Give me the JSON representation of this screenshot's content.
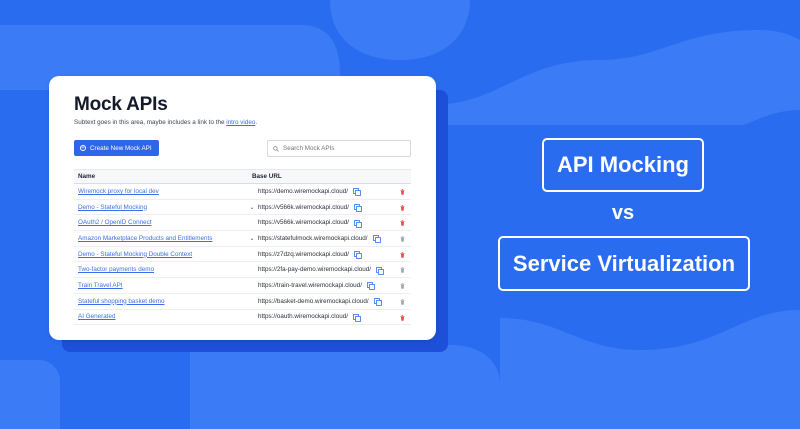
{
  "card": {
    "title": "Mock APIs",
    "subtext_prefix": "Subtext goes in this area, maybe includes a link to the ",
    "subtext_link": "intro video",
    "subtext_suffix": ".",
    "create_button_label": "Create New Mock API",
    "search_placeholder": "Search Mock APIs"
  },
  "table": {
    "headers": {
      "name": "Name",
      "url": "Base URL"
    },
    "rows": [
      {
        "name": "Wiremock proxy for local dev",
        "url": "https://demo.wiremockapi.cloud/",
        "expandable": false,
        "deletable": true
      },
      {
        "name": "Demo - Stateful Mocking",
        "url": "https://v566k.wiremockapi.cloud/",
        "expandable": true,
        "deletable": true
      },
      {
        "name": "OAuth2 / OpenID Connect",
        "url": "https://v566k.wiremockapi.cloud/",
        "expandable": false,
        "deletable": true
      },
      {
        "name": "Amazon Marketplace Products and Entitlements",
        "url": "https://statefulmock.wiremockapi.cloud/",
        "expandable": true,
        "deletable": false
      },
      {
        "name": "Demo - Stateful Mocking Double Context",
        "url": "https://z7dzq.wiremockapi.cloud/",
        "expandable": false,
        "deletable": true
      },
      {
        "name": "Two-factor payments demo",
        "url": "https://2fa-pay-demo.wiremockapi.cloud/",
        "expandable": false,
        "deletable": false
      },
      {
        "name": "Train Travel API",
        "url": "https://train-travel.wiremockapi.cloud/",
        "expandable": false,
        "deletable": false
      },
      {
        "name": "Stateful shopping basket demo",
        "url": "https://basket-demo.wiremockapi.cloud/",
        "expandable": false,
        "deletable": false
      },
      {
        "name": "AI Generated",
        "url": "https://oauth.wiremockapi.cloud/",
        "expandable": false,
        "deletable": true
      }
    ]
  },
  "labels": {
    "left_term": "API Mocking",
    "versus": "vs",
    "right_term": "Service Virtualization"
  },
  "colors": {
    "background": "#2a6cf0",
    "accent": "#2e66e9",
    "link": "#3a6fe8",
    "delete_active": "#e0534a"
  },
  "icons": {
    "search": "search-icon",
    "copy": "copy-icon",
    "delete": "trash-icon",
    "expand": "chevron-down-icon",
    "create": "plus-circle-icon"
  }
}
